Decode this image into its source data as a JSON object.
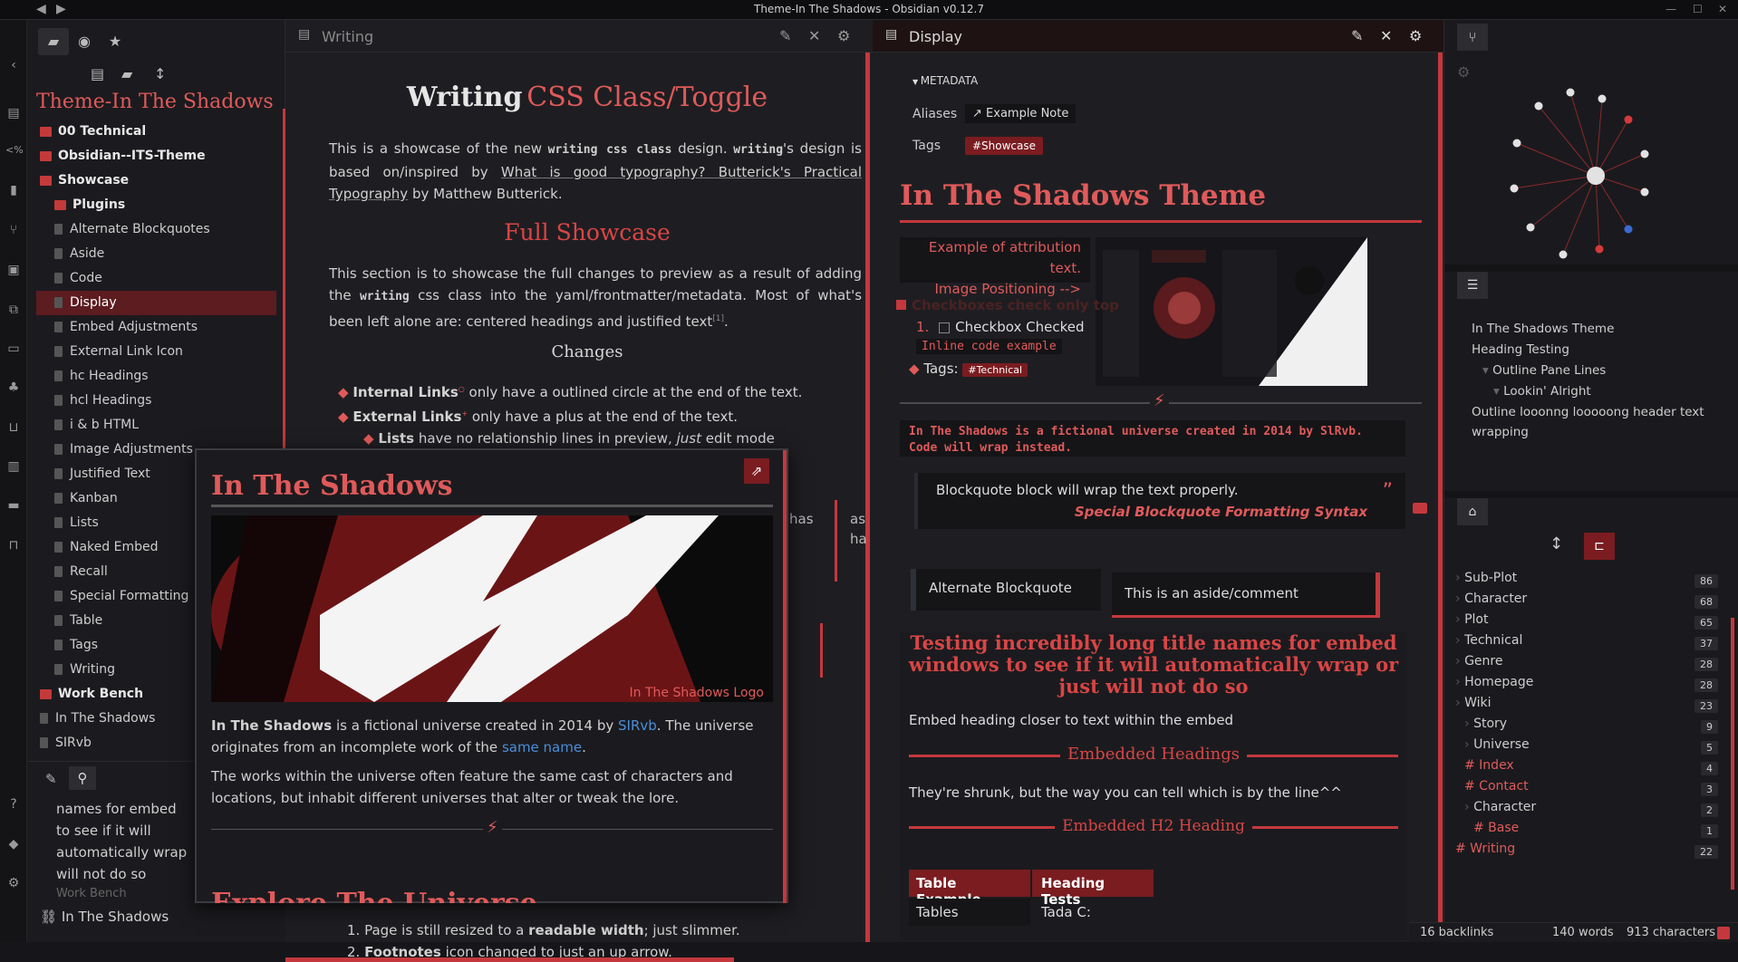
{
  "window": {
    "title": "Theme-In The Shadows - Obsidian v0.12.7"
  },
  "colors": {
    "accent": "#c4383d",
    "heading_red": "#e05a5a",
    "bg": "#1e1e22",
    "selection": "#5c1c20"
  },
  "explorer": {
    "vault_name": "Theme-In The Shadows",
    "items": [
      {
        "label": "00 Technical",
        "type": "folder"
      },
      {
        "label": "Obsidian--ITS-Theme",
        "type": "folder"
      },
      {
        "label": "Showcase",
        "type": "folder"
      },
      {
        "label": "Plugins",
        "type": "folder",
        "indent": 1
      },
      {
        "label": "Alternate Blockquotes",
        "type": "file",
        "indent": 1
      },
      {
        "label": "Aside",
        "type": "file",
        "indent": 1
      },
      {
        "label": "Code",
        "type": "file",
        "indent": 1
      },
      {
        "label": "Display",
        "type": "file",
        "indent": 1,
        "selected": true
      },
      {
        "label": "Embed Adjustments",
        "type": "file",
        "indent": 1
      },
      {
        "label": "External Link Icon",
        "type": "file",
        "indent": 1
      },
      {
        "label": "hc Headings",
        "type": "file",
        "indent": 1
      },
      {
        "label": "hcl Headings",
        "type": "file",
        "indent": 1
      },
      {
        "label": "i & b HTML",
        "type": "file",
        "indent": 1
      },
      {
        "label": "Image Adjustments",
        "type": "file",
        "indent": 1
      },
      {
        "label": "Justified Text",
        "type": "file",
        "indent": 1
      },
      {
        "label": "Kanban",
        "type": "file",
        "indent": 1
      },
      {
        "label": "Lists",
        "type": "file",
        "indent": 1
      },
      {
        "label": "Naked Embed",
        "type": "file",
        "indent": 1
      },
      {
        "label": "Recall",
        "type": "file",
        "indent": 1
      },
      {
        "label": "Special Formatting",
        "type": "file",
        "indent": 1
      },
      {
        "label": "Table",
        "type": "file",
        "indent": 1
      },
      {
        "label": "Tags",
        "type": "file",
        "indent": 1
      },
      {
        "label": "Writing",
        "type": "file",
        "indent": 1
      },
      {
        "label": "Work Bench",
        "type": "folder"
      },
      {
        "label": "In The Shadows",
        "type": "file"
      },
      {
        "label": "SIRvb",
        "type": "file"
      }
    ],
    "bottom": {
      "preview_lines": [
        "names for embed",
        "to see if it will",
        "automatically wrap",
        "will not do so"
      ],
      "preview_source": "Work Bench",
      "file": "In The Shadows"
    }
  },
  "writing": {
    "tab_title": "Writing",
    "h1_a": "Writing",
    "h1_b": "CSS Class/Toggle",
    "intro_1": "This is a showcase of the new",
    "intro_code": "writing css class",
    "intro_2": "design.",
    "intro_code2": "writing",
    "intro_3": "'s design is based on/inspired by",
    "intro_link": "What is good typography? Butterick's Practical Typography",
    "intro_4": "by Matthew Butterick.",
    "h2": "Full Showcase",
    "p2_1": "This section is to showcase the full changes to preview as a result of adding the",
    "p2_code": "writing",
    "p2_2": "css class into the yaml/frontmatter/metadata. Most of what's been left alone are: centered headings and justified text",
    "p2_fn": "[1]",
    "h3": "Changes",
    "li1_b": "Internal Links",
    "li1_t": "only have a outlined circle at the end of the text.",
    "li2_b": "External Links",
    "li2_t": "only have a plus at the end of the text.",
    "li3_b": "Lists",
    "li3_t": "have no relationship lines in preview,",
    "li3_i": "just",
    "li3_t2": "edit mode",
    "frag_has": "has",
    "frag_as": "as",
    "frag_ha": "ha",
    "bottom_1_num": "1.",
    "bottom_1": "Page is still resized to a",
    "bottom_1_b": "readable width",
    "bottom_1_t": "; just slimmer.",
    "bottom_2_num": "2.",
    "bottom_2_b": "Footnotes",
    "bottom_2_t": "icon changed to just an up arrow."
  },
  "popup": {
    "title": "In The Shadows",
    "caption": "In The Shadows Logo",
    "p1_b": "In The Shadows",
    "p1_1": "is a fictional universe created in 2014 by",
    "p1_link": "SIRvb",
    "p1_2": ". The universe originates from an incomplete work of the",
    "p1_link2": "same name",
    "p1_3": ".",
    "p2": "The works within the universe often feature the same cast of characters and locations, but inhabit different universes that alter or tweak the lore.",
    "cut_heading": "Explore The Universe"
  },
  "display": {
    "tab_title": "Display",
    "metadata_label": "METADATA",
    "aliases_label": "Aliases",
    "alias_value": "Example Note",
    "tags_label": "Tags",
    "tag_value": "#Showcase",
    "h1": "In The Shadows Theme",
    "attr_1": "Example of attribution text.",
    "attr_2": "Image Positioning -->",
    "check_heading": "Checkboxes check only top",
    "check_num": "1.",
    "check_item": "Checkbox Checked",
    "inline_code": "Inline code example",
    "tags_inline_label": "Tags:",
    "tags_inline_value": "#Technical",
    "code_block": "In The Shadows is a fictional universe created in 2014 by SlRvb. Code will wrap instead.",
    "blockquote": "Blockquote block will wrap the text properly.",
    "blockquote_cite": "Special Blockquote Formatting Syntax",
    "alt_blockquote": "Alternate Blockquote",
    "aside": "This is an aside/comment",
    "embed_title": "Testing incredibly long title names for embed windows to see if it will automatically wrap or just will not do so",
    "embed_p1": "Embed heading closer to text within the embed",
    "embed_h1": "Embedded Headings",
    "embed_p2": "They're shrunk, but the way you can tell which is by the line^^",
    "embed_h2": "Embedded H2 Heading",
    "table_headers": [
      "Table Example",
      "Heading Tests"
    ],
    "table_row": [
      "Tables",
      "Tada C:"
    ]
  },
  "outline": {
    "items": [
      {
        "label": "In The Shadows Theme",
        "level": 0
      },
      {
        "label": "Heading Testing",
        "level": 0
      },
      {
        "label": "Outline Pane Lines",
        "level": 1
      },
      {
        "label": "Lookin' Alright",
        "level": 2
      },
      {
        "label": "Outline looonng looooong header text wrapping",
        "level": 0
      }
    ]
  },
  "tags": {
    "items": [
      {
        "label": "Sub-Plot",
        "count": "86",
        "indent": 0
      },
      {
        "label": "Character",
        "count": "68",
        "indent": 0
      },
      {
        "label": "Plot",
        "count": "65",
        "indent": 0
      },
      {
        "label": "Technical",
        "count": "37",
        "indent": 0
      },
      {
        "label": "Genre",
        "count": "28",
        "indent": 0
      },
      {
        "label": "Homepage",
        "count": "28",
        "indent": 0
      },
      {
        "label": "Wiki",
        "count": "23",
        "indent": 0
      },
      {
        "label": "Story",
        "count": "9",
        "indent": 1
      },
      {
        "label": "Universe",
        "count": "5",
        "indent": 1
      },
      {
        "label": "# Index",
        "count": "4",
        "indent": 1
      },
      {
        "label": "# Contact",
        "count": "3",
        "indent": 1
      },
      {
        "label": "Character",
        "count": "2",
        "indent": 1
      },
      {
        "label": "# Base",
        "count": "1",
        "indent": 2
      },
      {
        "label": "# Writing",
        "count": "22",
        "indent": 0
      }
    ]
  },
  "status": {
    "backlinks": "16 backlinks",
    "words": "140 words",
    "chars": "913 characters"
  }
}
